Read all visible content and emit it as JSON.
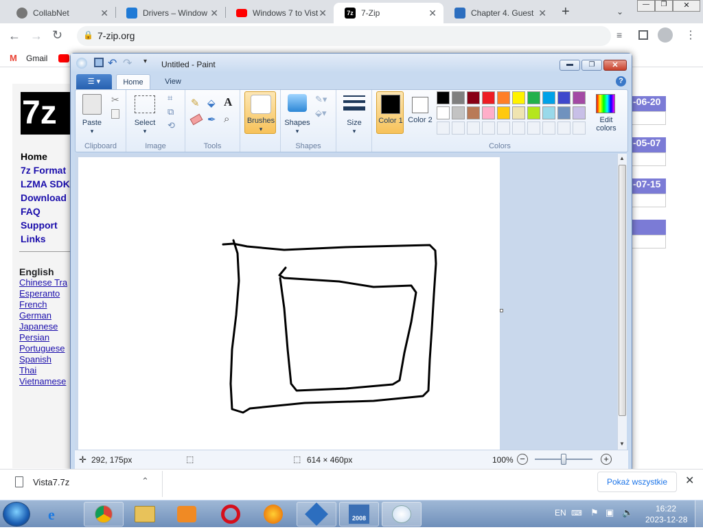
{
  "browser": {
    "tabs": [
      {
        "title": "CollabNet",
        "icon": "collabnet-icon",
        "color": "#888888"
      },
      {
        "title": "Drivers – Window",
        "icon": "windows-icon",
        "color": "#1f7ad6"
      },
      {
        "title": "Windows 7 to Vist",
        "icon": "youtube-icon",
        "color": "#ff0000"
      },
      {
        "title": "7-Zip",
        "icon": "7zip-icon",
        "color": "#000000"
      },
      {
        "title": "Chapter 4. Guest",
        "icon": "virtualbox-icon",
        "color": "#2c6ebf"
      }
    ],
    "url": "7-zip.org",
    "bookmarks": [
      {
        "label": "Gmail"
      }
    ]
  },
  "site": {
    "nav": [
      "Home",
      "7z Format",
      "LZMA SDK",
      "Download",
      "FAQ",
      "Support",
      "Links"
    ],
    "lang_title": "English",
    "languages": [
      "Chinese Tra",
      "Esperanto",
      "French",
      "German",
      "Japanese",
      "Persian",
      "Portuguese",
      "Spanish",
      "Thai",
      "Vietnamese"
    ],
    "dates": [
      "-06-20",
      "-05-07",
      "-07-15"
    ]
  },
  "paint": {
    "title": "Untitled - Paint",
    "tabs": [
      "Home",
      "View"
    ],
    "groups": {
      "clipboard": {
        "label": "Clipboard",
        "paste": "Paste"
      },
      "image": {
        "label": "Image",
        "select": "Select"
      },
      "tools": {
        "label": "Tools"
      },
      "brushes": "Brushes",
      "shapes": {
        "label": "Shapes",
        "button": "Shapes"
      },
      "size": "Size",
      "colors": {
        "label": "Colors",
        "color1": "Color 1",
        "color2": "Color 2",
        "edit": "Edit colors"
      }
    },
    "palette_row1": [
      "#000000",
      "#7f7f7f",
      "#880015",
      "#ed1c24",
      "#ff7f27",
      "#fff200",
      "#22b14c",
      "#00a2e8",
      "#3f48cc",
      "#a349a4"
    ],
    "palette_row2": [
      "#ffffff",
      "#c3c3c3",
      "#b97a57",
      "#ffaec9",
      "#ffc90e",
      "#efe4b0",
      "#b5e61d",
      "#99d9ea",
      "#7092be",
      "#c8bfe7"
    ],
    "color1": "#000000",
    "color2": "#ffffff",
    "status": {
      "cursor": "292, 175px",
      "size": "614 × 460px",
      "zoom": "100%"
    }
  },
  "downloads": {
    "file": "Vista7.7z",
    "show_all": "Pokaż wszystkie"
  },
  "taskbar": {
    "lang": "EN",
    "time": "16:22",
    "date": "2023-12-28"
  }
}
